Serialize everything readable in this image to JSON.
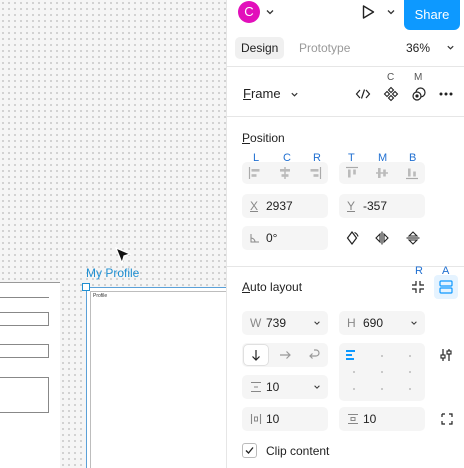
{
  "canvas": {
    "frame_label": "My Profile",
    "inner_frame_label": "Profile"
  },
  "topbar": {
    "avatar_initial": "C",
    "avatar_color": "#e20fbb",
    "share_label": "Share",
    "share_color": "#0d99ff"
  },
  "tabs": {
    "design": "Design",
    "prototype": "Prototype",
    "zoom": "36%"
  },
  "frame_section": {
    "title": "Frame",
    "hint_code": "C",
    "hint_mask": "M",
    "icons": [
      "code-icon",
      "component-icon",
      "mask-icon",
      "more-icon"
    ]
  },
  "position": {
    "title": "Position",
    "align_labels": [
      "L",
      "C",
      "R",
      "T",
      "M",
      "B"
    ],
    "x_label": "X",
    "x_value": "2937",
    "y_label": "Y",
    "y_value": "-357",
    "rotation_value": "0°"
  },
  "auto_layout": {
    "title": "Auto layout",
    "hint_remove": "R",
    "hint_toggle": "A",
    "width_label": "W",
    "width_value": "739",
    "height_label": "H",
    "height_value": "690",
    "gap_value": "10",
    "padding_h_value": "10",
    "padding_v_value": "10",
    "clip_content_label": "Clip content",
    "clip_content_checked": true
  }
}
